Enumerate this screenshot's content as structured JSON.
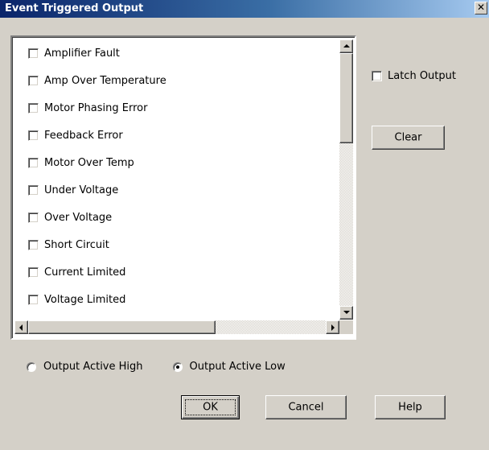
{
  "window": {
    "title": "Event Triggered Output",
    "close_glyph": "✕"
  },
  "event_list": {
    "items": [
      {
        "label": "Amplifier Fault",
        "checked": false
      },
      {
        "label": "Amp Over Temperature",
        "checked": false
      },
      {
        "label": "Motor Phasing Error",
        "checked": false
      },
      {
        "label": "Feedback Error",
        "checked": false
      },
      {
        "label": "Motor Over Temp",
        "checked": false
      },
      {
        "label": "Under Voltage",
        "checked": false
      },
      {
        "label": "Over Voltage",
        "checked": false
      },
      {
        "label": "Short Circuit",
        "checked": false
      },
      {
        "label": "Current Limited",
        "checked": false
      },
      {
        "label": "Voltage Limited",
        "checked": false
      }
    ]
  },
  "latch": {
    "label": "Latch Output",
    "checked": false
  },
  "clear_button": {
    "label": "Clear"
  },
  "output_polarity": {
    "options": [
      {
        "label": "Output Active High",
        "selected": false
      },
      {
        "label": "Output Active Low",
        "selected": true
      }
    ]
  },
  "buttons": {
    "ok": "OK",
    "cancel": "Cancel",
    "help": "Help"
  },
  "colors": {
    "title_bar_start": "#0a246a",
    "title_bar_end": "#a6caf0",
    "dialog_face": "#d4d0c8"
  }
}
